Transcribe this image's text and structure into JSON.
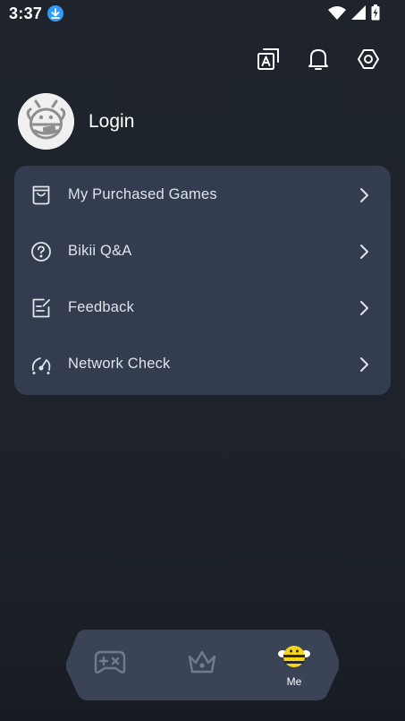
{
  "status_bar": {
    "time": "3:37",
    "icons": [
      "download-badge-icon",
      "wifi-icon",
      "signal-icon",
      "battery-charging-icon"
    ]
  },
  "top_actions": {
    "icons": [
      "translate-icon",
      "bell-icon",
      "settings-hex-icon"
    ]
  },
  "profile": {
    "login_label": "Login",
    "avatar_icon": "bee-avatar-icon"
  },
  "menu": {
    "items": [
      {
        "label": "My Purchased Games",
        "icon": "shopping-bag-icon"
      },
      {
        "label": "Bikii Q&A",
        "icon": "question-circle-icon"
      },
      {
        "label": "Feedback",
        "icon": "edit-note-icon"
      },
      {
        "label": "Network Check",
        "icon": "speedometer-icon"
      }
    ]
  },
  "bottom_nav": {
    "items": [
      {
        "icon": "gamepad-icon",
        "label": ""
      },
      {
        "icon": "crown-icon",
        "label": ""
      },
      {
        "icon": "bee-icon",
        "label": "Me"
      }
    ],
    "active_index": 2,
    "accent_color": "#f7d51c"
  },
  "colors": {
    "background": "#1f242c",
    "card": "#333d4f",
    "nav_bg": "#3a4456",
    "text": "#dfe4ec"
  }
}
